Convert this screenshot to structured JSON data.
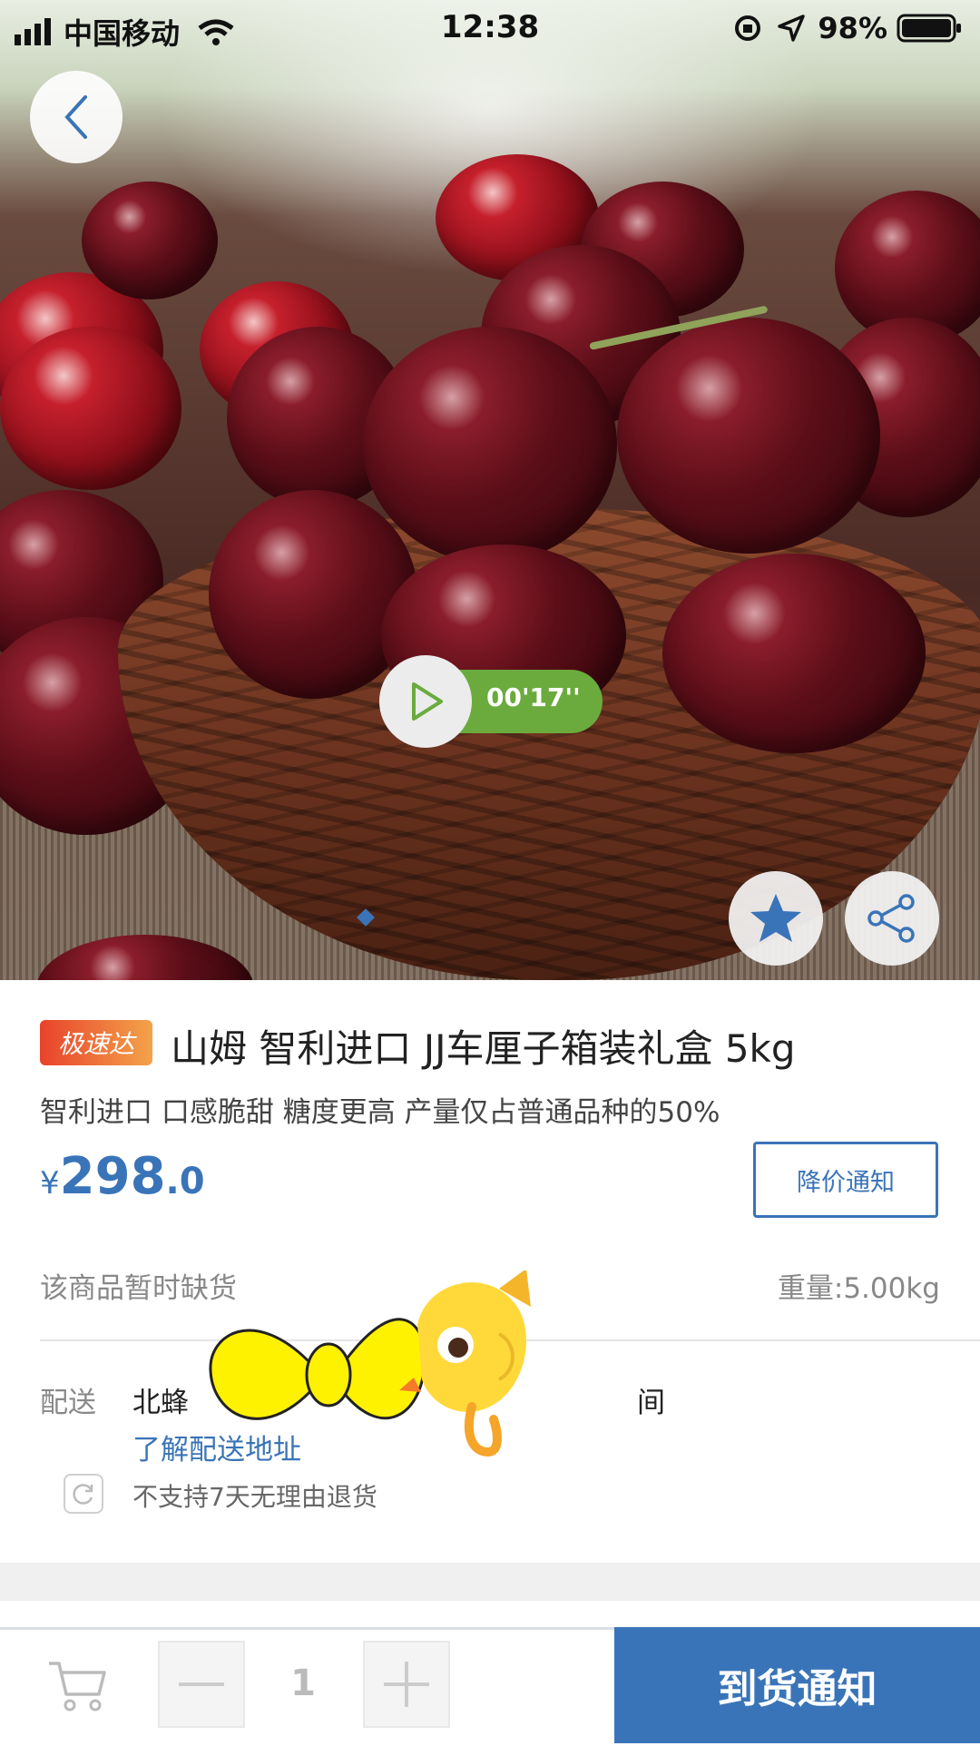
{
  "status_bar": {
    "carrier": "中国移动",
    "time": "12:38",
    "battery": "98%"
  },
  "hero": {
    "video_duration": "00'17''"
  },
  "product": {
    "badge": "极速达",
    "title": "山姆 智利进口 JJ车厘子箱装礼盒 5kg",
    "subtitle": "智利进口  口感脆甜 糖度更高  产量仅占普通品种的50%",
    "price_symbol": "¥",
    "price_integer": "298",
    "price_decimal": ".0",
    "price_notify_label": "降价通知",
    "stock_status": "该商品暂时缺货",
    "weight": "重量:5.00kg"
  },
  "delivery": {
    "label": "配送",
    "text_start": "北蜂",
    "text_end": "间",
    "address_link": "了解配送地址",
    "return_policy": "不支持7天无理由退货"
  },
  "bottom_bar": {
    "quantity": "1",
    "arrival_notify_label": "到货通知"
  },
  "colors": {
    "accent": "#3a74b8",
    "video_pill": "#6bab3e",
    "badge_start": "#e9432c",
    "badge_end": "#f3a34a"
  }
}
